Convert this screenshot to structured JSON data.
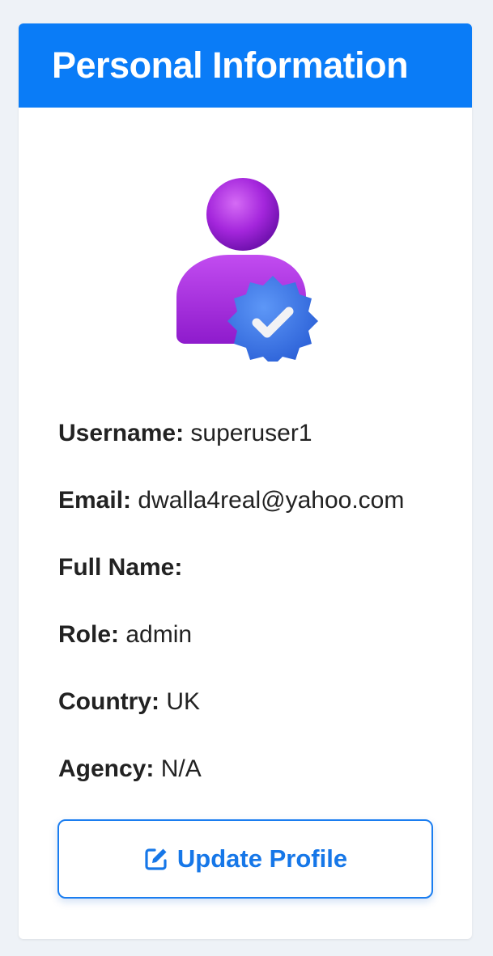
{
  "header": {
    "title": "Personal Information"
  },
  "avatar": {
    "icon": "verified-user-icon",
    "body_color": "#a020d8",
    "badge_color": "#3a78e8"
  },
  "fields": [
    {
      "label": "Username:",
      "value": "superuser1"
    },
    {
      "label": "Email:",
      "value": "dwalla4real@yahoo.com"
    },
    {
      "label": "Full Name:",
      "value": ""
    },
    {
      "label": "Role:",
      "value": "admin"
    },
    {
      "label": "Country:",
      "value": "UK"
    },
    {
      "label": "Agency:",
      "value": "N/A"
    }
  ],
  "actions": {
    "update_label": "Update Profile",
    "update_icon": "edit-icon"
  },
  "colors": {
    "accent": "#0a7cf7",
    "page_bg": "#eef2f7"
  }
}
